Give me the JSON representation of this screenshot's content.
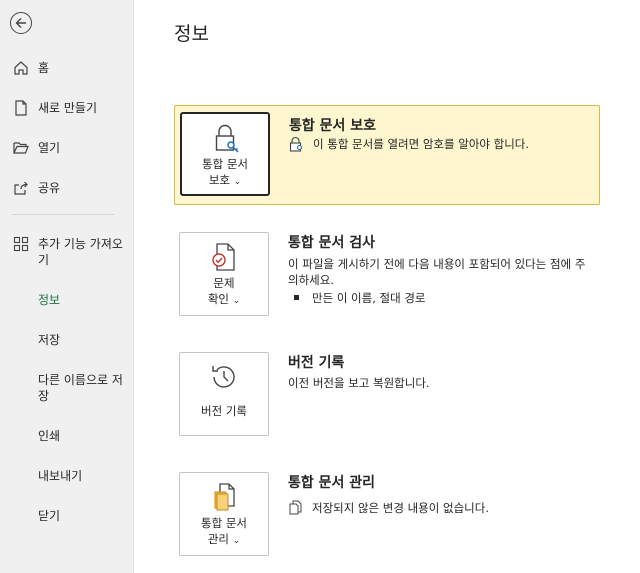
{
  "sidebar": {
    "back_icon": "arrow-left-circle-icon",
    "items": [
      {
        "label": "홈",
        "icon": "home-icon"
      },
      {
        "label": "새로 만들기",
        "icon": "new-document-icon"
      },
      {
        "label": "열기",
        "icon": "folder-open-icon"
      },
      {
        "label": "공유",
        "icon": "share-icon"
      },
      {
        "label": "추가 기능 가져오기",
        "icon": "addins-grid-icon"
      },
      {
        "label": "정보"
      },
      {
        "label": "저장"
      },
      {
        "label": "다른 이름으로 저장"
      },
      {
        "label": "인쇄"
      },
      {
        "label": "내보내기"
      },
      {
        "label": "닫기"
      }
    ],
    "active_label": "정보",
    "active_color": "#1e7145"
  },
  "page": {
    "title": "정보"
  },
  "sections": {
    "protect": {
      "tile_line1": "통합 문서",
      "tile_line2": "보호",
      "title": "통합 문서 보호",
      "desc": "이 통합 문서를 열려면 암호를 알아야 합니다.",
      "highlight_bg": "#fdf6cf",
      "highlight_border": "#d9b949"
    },
    "inspect": {
      "tile_line1": "문제",
      "tile_line2": "확인",
      "title": "통합 문서 검사",
      "desc": "이 파일을 게시하기 전에 다음 내용이 포함되어 있다는 점에 주의하세요.",
      "bullet": "만든 이 이름, 절대 경로"
    },
    "history": {
      "tile_label": "버전 기록",
      "title": "버전 기록",
      "desc": "이전 버전을 보고 복원합니다."
    },
    "manage": {
      "tile_line1": "통합 문서",
      "tile_line2": "관리",
      "title": "통합 문서 관리",
      "desc": "저장되지 않은 변경 내용이 없습니다."
    }
  }
}
